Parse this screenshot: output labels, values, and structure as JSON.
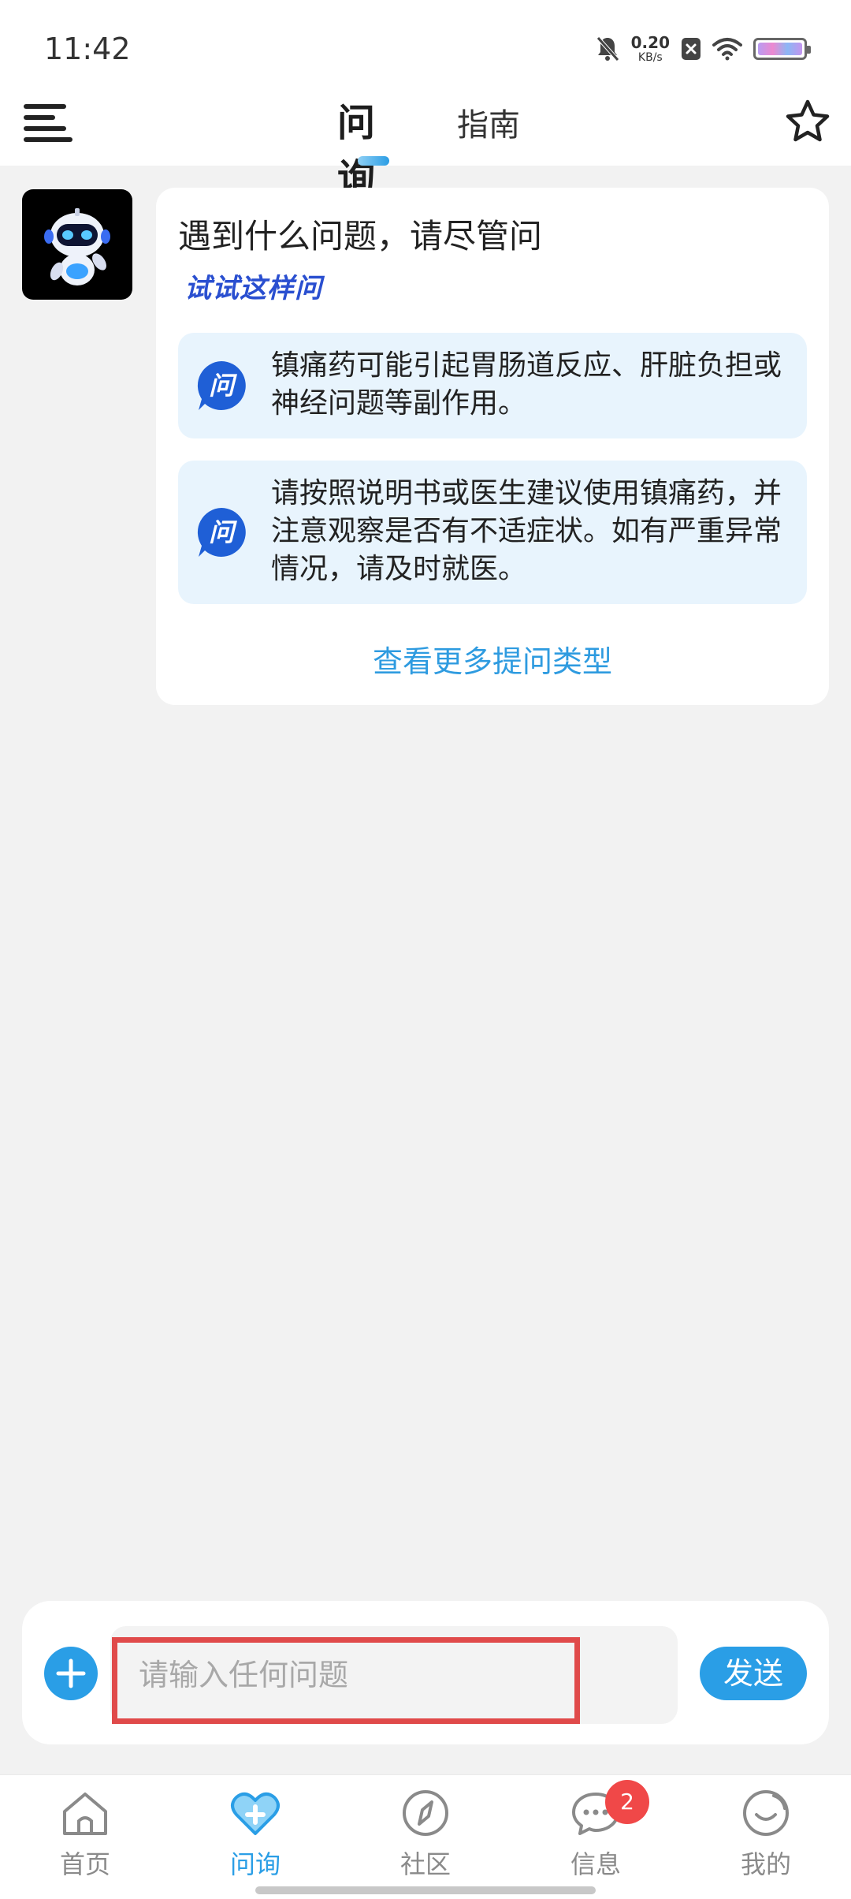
{
  "status_bar": {
    "time": "11:42",
    "net_speed_value": "0.20",
    "net_speed_unit": "KB/s",
    "icons": [
      "bell-off-icon",
      "close-box-icon",
      "wifi-icon",
      "battery-icon"
    ]
  },
  "header": {
    "tabs": [
      {
        "label": "问询",
        "active": true
      },
      {
        "label": "指南",
        "active": false
      }
    ],
    "menu_icon": "menu-icon",
    "star_icon": "star-icon"
  },
  "chat": {
    "greeting": "遇到什么问题，请尽管问",
    "try_label": "试试这样问",
    "suggestions": [
      {
        "badge": "问",
        "text": "镇痛药可能引起胃肠道反应、肝脏负担或神经问题等副作用。"
      },
      {
        "badge": "问",
        "text": "请按照说明书或医生建议使用镇痛药，并注意观察是否有不适症状。如有严重异常情况，请及时就医。"
      }
    ],
    "more_link": "查看更多提问类型"
  },
  "composer": {
    "placeholder": "请输入任何问题",
    "value": "",
    "send_label": "发送"
  },
  "bottom_nav": {
    "items": [
      {
        "label": "首页",
        "icon": "home-icon",
        "active": false
      },
      {
        "label": "问询",
        "icon": "heart-plus-icon",
        "active": true
      },
      {
        "label": "社区",
        "icon": "compass-icon",
        "active": false
      },
      {
        "label": "信息",
        "icon": "chat-bubble-icon",
        "active": false,
        "badge": "2"
      },
      {
        "label": "我的",
        "icon": "smiley-icon",
        "active": false
      }
    ]
  },
  "colors": {
    "accent": "#2a9ee6",
    "highlight": "#e04a4a",
    "suggestion_bg": "#e8f4fd",
    "try_label": "#2a4fd0"
  }
}
